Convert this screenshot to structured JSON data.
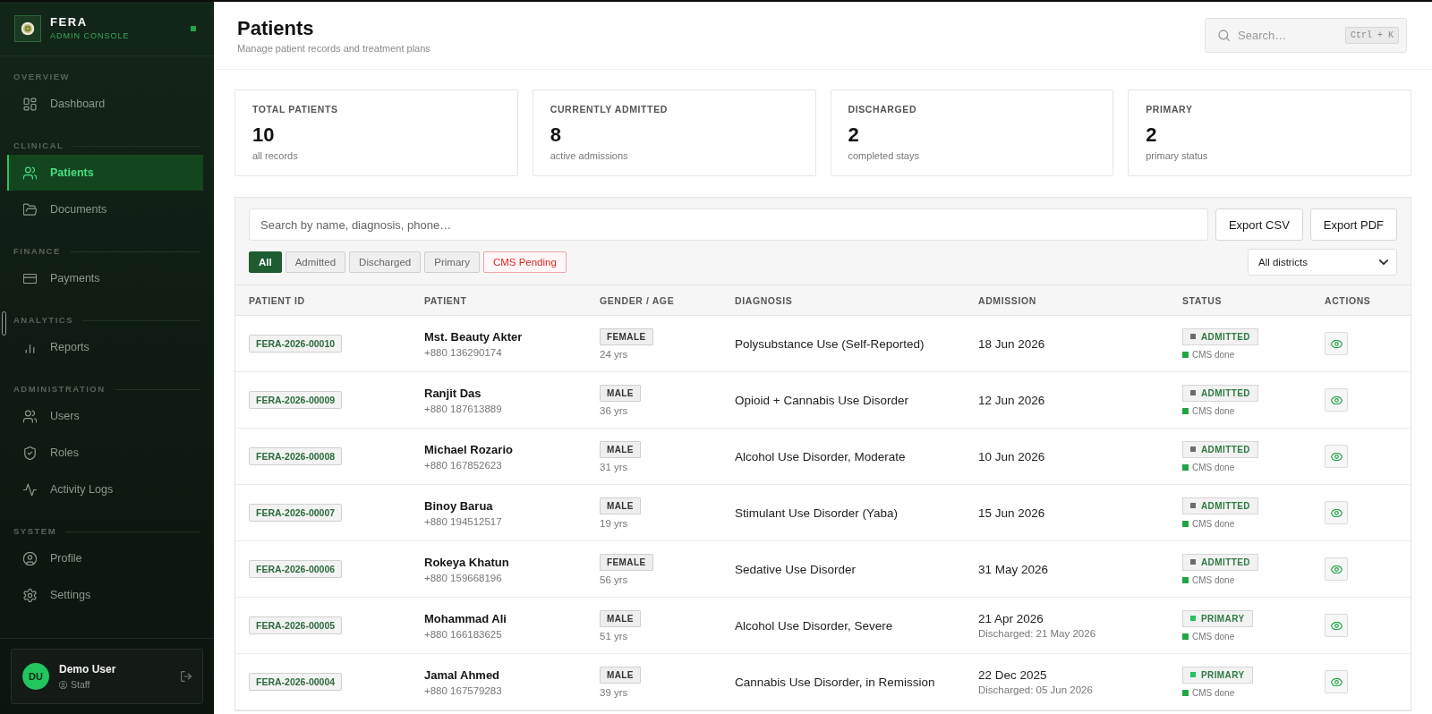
{
  "sidebar": {
    "brand": {
      "name": "FERA",
      "subtitle": "ADMIN CONSOLE"
    },
    "sections": [
      {
        "label": "OVERVIEW",
        "rule": false,
        "items": [
          {
            "label": "Dashboard",
            "selected": false
          }
        ]
      },
      {
        "label": "CLINICAL",
        "rule": true,
        "items": [
          {
            "label": "Patients",
            "selected": true
          },
          {
            "label": "Documents",
            "selected": false
          }
        ]
      },
      {
        "label": "FINANCE",
        "rule": true,
        "items": [
          {
            "label": "Payments",
            "selected": false
          }
        ]
      },
      {
        "label": "ANALYTICS",
        "rule": true,
        "items": [
          {
            "label": "Reports",
            "selected": false
          }
        ]
      },
      {
        "label": "ADMINISTRATION",
        "rule": true,
        "items": [
          {
            "label": "Users",
            "selected": false
          },
          {
            "label": "Roles",
            "selected": false
          },
          {
            "label": "Activity Logs",
            "selected": false
          }
        ]
      },
      {
        "label": "SYSTEM",
        "rule": true,
        "items": [
          {
            "label": "Profile",
            "selected": false
          },
          {
            "label": "Settings",
            "selected": false
          }
        ]
      }
    ],
    "user": {
      "initials": "DU",
      "name": "Demo User",
      "role": "Staff"
    }
  },
  "header": {
    "title": "Patients",
    "subtitle": "Manage patient records and treatment plans",
    "search": {
      "placeholder": "Search…",
      "shortcut": "Ctrl + K"
    }
  },
  "stats": [
    {
      "label": "TOTAL PATIENTS",
      "value": "10",
      "caption": "all records"
    },
    {
      "label": "CURRENTLY ADMITTED",
      "value": "8",
      "caption": "active admissions"
    },
    {
      "label": "DISCHARGED",
      "value": "2",
      "caption": "completed stays"
    },
    {
      "label": "PRIMARY",
      "value": "2",
      "caption": "primary status"
    }
  ],
  "filters": {
    "search": {
      "placeholder": "Search by name, diagnosis, phone…"
    },
    "buttons": [
      "Export CSV",
      "Export PDF"
    ],
    "chips": [
      {
        "label": "All",
        "selected": true,
        "kind": "filter"
      },
      {
        "label": "Admitted",
        "selected": false,
        "kind": "filter"
      },
      {
        "label": "Discharged",
        "selected": false,
        "kind": "filter"
      },
      {
        "label": "Primary",
        "selected": false,
        "kind": "filter"
      },
      {
        "label": "CMS Pending",
        "selected": false,
        "kind": "alert"
      }
    ],
    "district": {
      "value": "All districts"
    }
  },
  "table": {
    "columns": [
      "PATIENT ID",
      "PATIENT",
      "GENDER / AGE",
      "DIAGNOSIS",
      "ADMISSION",
      "STATUS",
      "ACTIONS"
    ],
    "rows": [
      {
        "id": "FERA-2026-00010",
        "name": "Mst. Beauty Akter",
        "phone": "+880 136290174",
        "gender": "FEMALE",
        "age": "24 yrs",
        "diagnosis": "Polysubstance Use (Self-Reported)",
        "admission": {
          "date": "18 Jun 2026"
        },
        "status": {
          "label": "ADMITTED",
          "color": "#6b6b6b"
        },
        "cms": {
          "label": "CMS done",
          "color": "#22a447"
        }
      },
      {
        "id": "FERA-2026-00009",
        "name": "Ranjit Das",
        "phone": "+880 187613889",
        "gender": "MALE",
        "age": "36 yrs",
        "diagnosis": "Opioid + Cannabis Use Disorder",
        "admission": {
          "date": "12 Jun 2026"
        },
        "status": {
          "label": "ADMITTED",
          "color": "#6b6b6b"
        },
        "cms": {
          "label": "CMS done",
          "color": "#22a447"
        }
      },
      {
        "id": "FERA-2026-00008",
        "name": "Michael Rozario",
        "phone": "+880 167852623",
        "gender": "MALE",
        "age": "31 yrs",
        "diagnosis": "Alcohol Use Disorder, Moderate",
        "admission": {
          "date": "10 Jun 2026"
        },
        "status": {
          "label": "ADMITTED",
          "color": "#6b6b6b"
        },
        "cms": {
          "label": "CMS done",
          "color": "#22a447"
        }
      },
      {
        "id": "FERA-2026-00007",
        "name": "Binoy Barua",
        "phone": "+880 194512517",
        "gender": "MALE",
        "age": "19 yrs",
        "diagnosis": "Stimulant Use Disorder (Yaba)",
        "admission": {
          "date": "15 Jun 2026"
        },
        "status": {
          "label": "ADMITTED",
          "color": "#6b6b6b"
        },
        "cms": {
          "label": "CMS done",
          "color": "#22a447"
        }
      },
      {
        "id": "FERA-2026-00006",
        "name": "Rokeya Khatun",
        "phone": "+880 159668196",
        "gender": "FEMALE",
        "age": "56 yrs",
        "diagnosis": "Sedative Use Disorder",
        "admission": {
          "date": "31 May 2026"
        },
        "status": {
          "label": "ADMITTED",
          "color": "#6b6b6b"
        },
        "cms": {
          "label": "CMS done",
          "color": "#22a447"
        }
      },
      {
        "id": "FERA-2026-00005",
        "name": "Mohammad Ali",
        "phone": "+880 166183625",
        "gender": "MALE",
        "age": "51 yrs",
        "diagnosis": "Alcohol Use Disorder, Severe",
        "admission": {
          "date": "21 Apr 2026",
          "discharged": "Discharged: 21 May 2026"
        },
        "status": {
          "label": "PRIMARY",
          "color": "#22c55e"
        },
        "cms": {
          "label": "CMS done",
          "color": "#22a447"
        }
      },
      {
        "id": "FERA-2026-00004",
        "name": "Jamal Ahmed",
        "phone": "+880 167579283",
        "gender": "MALE",
        "age": "39 yrs",
        "diagnosis": "Cannabis Use Disorder, in Remission",
        "admission": {
          "date": "22 Dec 2025",
          "discharged": "Discharged: 05 Jun 2026"
        },
        "status": {
          "label": "PRIMARY",
          "color": "#22c55e"
        },
        "cms": {
          "label": "CMS done",
          "color": "#22a447"
        }
      }
    ]
  }
}
